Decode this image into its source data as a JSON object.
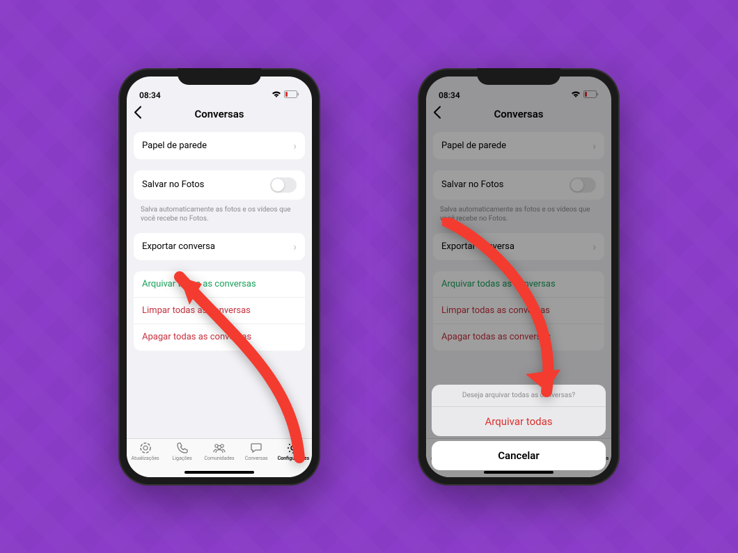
{
  "status": {
    "time": "08:34"
  },
  "header": {
    "title": "Conversas"
  },
  "settings": {
    "wallpaper": "Papel de parede",
    "save_photos": "Salvar no Fotos",
    "save_photos_note": "Salva automaticamente as fotos e os vídeos que você recebe no Fotos.",
    "export": "Exportar conversa",
    "archive_all": "Arquivar todas as conversas",
    "clear_all": "Limpar todas as conversas",
    "delete_all": "Apagar todas as conversas"
  },
  "tabs": {
    "updates": "Atualizações",
    "calls": "Ligações",
    "communities": "Comunidades",
    "chats": "Conversas",
    "settings": "Configurações"
  },
  "actionsheet": {
    "prompt": "Deseja arquivar todas as conversas?",
    "confirm": "Arquivar todas",
    "cancel": "Cancelar"
  },
  "colors": {
    "bg": "#8b3dc9",
    "green": "#1ba05a",
    "red": "#c6303e",
    "sheet_red": "#d9322f"
  }
}
